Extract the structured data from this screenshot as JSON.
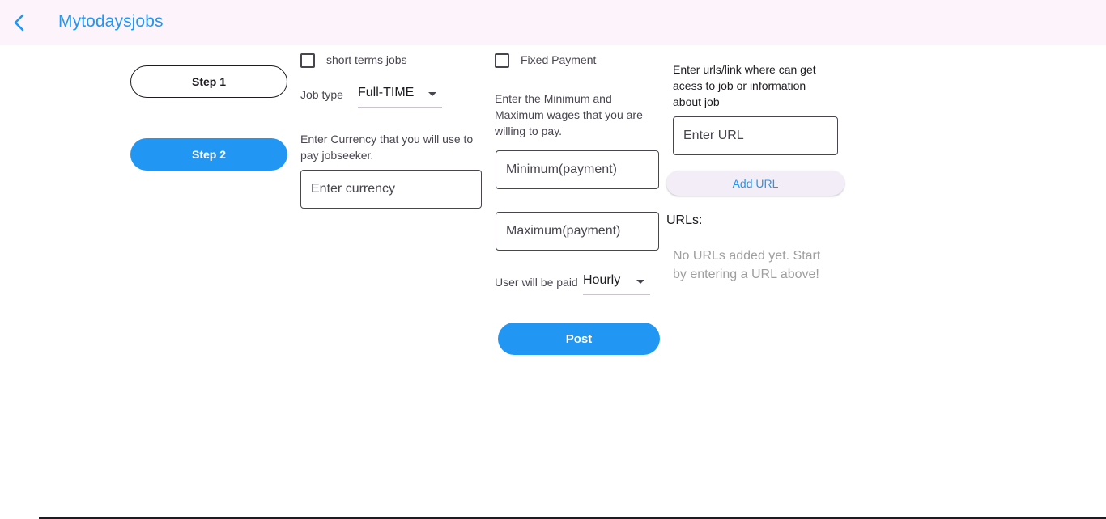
{
  "app": {
    "title": "Mytodaysjobs"
  },
  "steps": {
    "step1": "Step 1",
    "step2": "Step 2"
  },
  "job": {
    "short_terms_label": "short terms jobs",
    "short_terms_checked": false,
    "job_type_label": "Job type",
    "job_type_value": "Full-TIME",
    "currency_prompt": "Enter Currency that you will use to pay jobseeker.",
    "currency_placeholder": "Enter currency"
  },
  "payment": {
    "fixed_label": "Fixed Payment",
    "fixed_checked": false,
    "wages_prompt": "Enter the Minimum and Maximum wages that you are willing to pay.",
    "min_placeholder": "Minimum(payment)",
    "max_placeholder": "Maximum(payment)",
    "paid_label": "User will be paid",
    "paid_value": "Hourly"
  },
  "urls": {
    "prompt": "Enter urls/link where can get acess to job or information about job",
    "placeholder": "Enter URL",
    "add_label": "Add URL",
    "title": "URLs:",
    "empty_message": "No URLs added yet. Start by entering a URL above!"
  },
  "actions": {
    "post_label": "Post"
  },
  "colors": {
    "accent": "#2196f3",
    "appbar_bg": "#fdf3fb"
  },
  "icons": {
    "back": "arrow-back-icon",
    "dropdown": "dropdown-arrow-icon"
  }
}
